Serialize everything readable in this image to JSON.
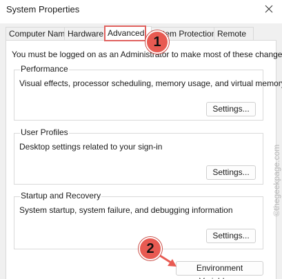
{
  "window": {
    "title": "System Properties"
  },
  "tabs": [
    {
      "label": "Computer Name"
    },
    {
      "label": "Hardware"
    },
    {
      "label": "Advanced"
    },
    {
      "label": "System Protection"
    },
    {
      "label": "Remote"
    }
  ],
  "admin_note": "You must be logged on as an Administrator to make most of these changes.",
  "groups": {
    "performance": {
      "legend": "Performance",
      "description": "Visual effects, processor scheduling, memory usage, and virtual memory",
      "button": "Settings..."
    },
    "user_profiles": {
      "legend": "User Profiles",
      "description": "Desktop settings related to your sign-in",
      "button": "Settings..."
    },
    "startup_recovery": {
      "legend": "Startup and Recovery",
      "description": "System startup, system failure, and debugging information",
      "button": "Settings..."
    }
  },
  "env_button": "Environment Variables...",
  "annotations": {
    "step1": "1",
    "step2": "2",
    "accent_color": "#e85a52"
  },
  "watermark": "©thegeekpage.com"
}
